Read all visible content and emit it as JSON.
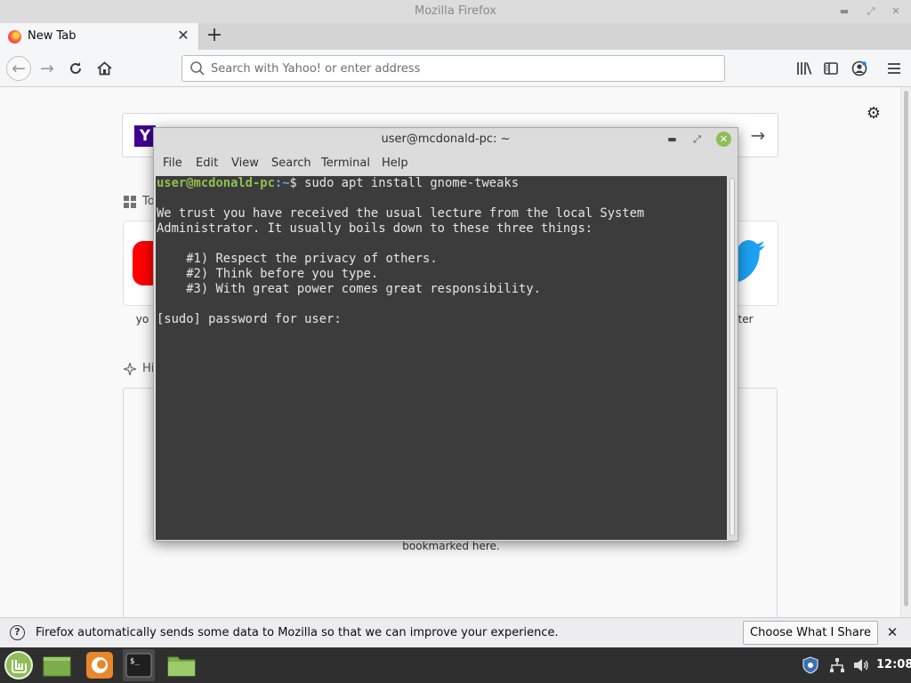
{
  "firefox": {
    "window_title": "Mozilla Firefox",
    "tab": {
      "title": "New Tab"
    },
    "url_bar": {
      "placeholder": "Search with Yahoo! or enter address"
    },
    "newtab": {
      "yahoo_logo": "Y",
      "top_sites_label": "To",
      "highlights_label": "Hi",
      "tiles": [
        {
          "label": "yo",
          "icon": "youtube-icon",
          "color": "#ff0000"
        },
        {
          "label": "ter",
          "icon": "twitter-icon",
          "color": "#1da1f2"
        }
      ],
      "highlights_message": "bookmarked here."
    },
    "notification": {
      "text": "Firefox automatically sends some data to Mozilla so that we can improve your experience.",
      "button": "Choose What I Share"
    }
  },
  "terminal": {
    "title": "user@mcdonald-pc: ~",
    "menu": [
      "File",
      "Edit",
      "View",
      "Search",
      "Terminal",
      "Help"
    ],
    "prompt_user": "user@mcdonald-pc",
    "prompt_path": ":~",
    "prompt_symbol": "$",
    "command": " sudo apt install gnome-tweaks",
    "output": [
      "",
      "We trust you have received the usual lecture from the local System",
      "Administrator. It usually boils down to these three things:",
      "",
      "    #1) Respect the privacy of others.",
      "    #2) Think before you type.",
      "    #3) With great power comes great responsibility.",
      "",
      "[sudo] password for user: "
    ]
  },
  "taskbar": {
    "clock": "12:08",
    "items": [
      "mint-menu-icon",
      "show-desktop-icon",
      "firefox-icon",
      "terminal-icon",
      "files-icon"
    ]
  },
  "colors": {
    "terminal_bg": "#3c3c3c",
    "prompt_user": "#8fc14f",
    "prompt_path": "#6fa8dc",
    "taskbar_bg": "#2f2f2f",
    "mint_green": "#8fbd5a"
  }
}
